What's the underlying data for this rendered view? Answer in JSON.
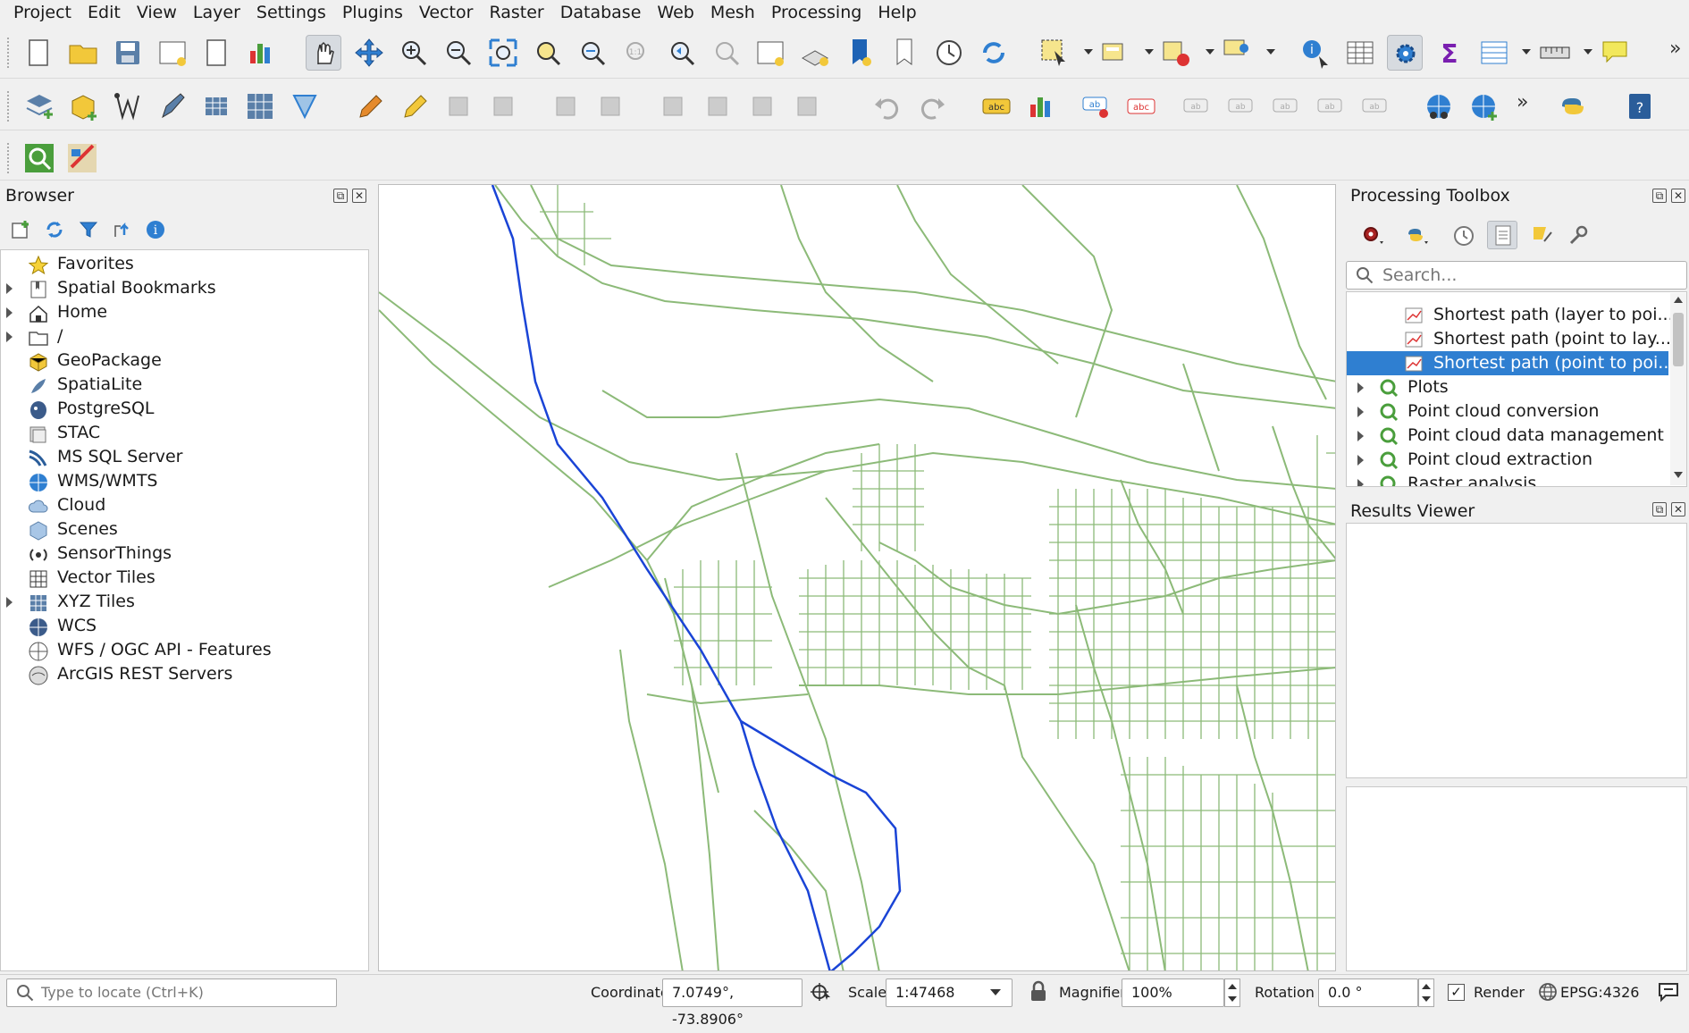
{
  "menu": [
    "Project",
    "Edit",
    "View",
    "Layer",
    "Settings",
    "Plugins",
    "Vector",
    "Raster",
    "Database",
    "Web",
    "Mesh",
    "Processing",
    "Help"
  ],
  "browser": {
    "title": "Browser",
    "items": [
      {
        "label": "Favorites",
        "icon": "star-icon",
        "expandable": false
      },
      {
        "label": "Spatial Bookmarks",
        "icon": "bookmark-icon",
        "expandable": true
      },
      {
        "label": "Home",
        "icon": "home-icon",
        "expandable": true
      },
      {
        "label": "/",
        "icon": "folder-icon",
        "expandable": true
      },
      {
        "label": "GeoPackage",
        "icon": "geopackage-icon",
        "expandable": false
      },
      {
        "label": "SpatiaLite",
        "icon": "spatialite-icon",
        "expandable": false
      },
      {
        "label": "PostgreSQL",
        "icon": "postgresql-icon",
        "expandable": false
      },
      {
        "label": "STAC",
        "icon": "stac-icon",
        "expandable": false
      },
      {
        "label": "MS SQL Server",
        "icon": "mssql-icon",
        "expandable": false
      },
      {
        "label": "WMS/WMTS",
        "icon": "wms-icon",
        "expandable": false
      },
      {
        "label": "Cloud",
        "icon": "cloud-icon",
        "expandable": false
      },
      {
        "label": "Scenes",
        "icon": "scenes-icon",
        "expandable": false
      },
      {
        "label": "SensorThings",
        "icon": "sensorthings-icon",
        "expandable": false
      },
      {
        "label": "Vector Tiles",
        "icon": "vector-tiles-icon",
        "expandable": false
      },
      {
        "label": "XYZ Tiles",
        "icon": "xyz-tiles-icon",
        "expandable": true
      },
      {
        "label": "WCS",
        "icon": "wcs-icon",
        "expandable": false
      },
      {
        "label": "WFS / OGC API - Features",
        "icon": "wfs-icon",
        "expandable": false
      },
      {
        "label": "ArcGIS REST Servers",
        "icon": "arcgis-icon",
        "expandable": false
      }
    ]
  },
  "toolbox": {
    "title": "Processing Toolbox",
    "search_placeholder": "Search...",
    "items": [
      {
        "label": "Shortest path (layer to poi...",
        "type": "algorithm",
        "selected": false
      },
      {
        "label": "Shortest path (point to lay...",
        "type": "algorithm",
        "selected": false
      },
      {
        "label": "Shortest path (point to poi...",
        "type": "algorithm",
        "selected": true
      },
      {
        "label": "Plots",
        "type": "group",
        "selected": false
      },
      {
        "label": "Point cloud conversion",
        "type": "group",
        "selected": false
      },
      {
        "label": "Point cloud data management",
        "type": "group",
        "selected": false
      },
      {
        "label": "Point cloud extraction",
        "type": "group",
        "selected": false
      },
      {
        "label": "Raster analysis",
        "type": "group",
        "selected": false
      }
    ]
  },
  "results": {
    "title": "Results Viewer"
  },
  "status": {
    "locate_placeholder": "Type to locate (Ctrl+K)",
    "coordinate_label": "Coordinate",
    "coordinate_value": "7.0749°, -73.8906°",
    "scale_label": "Scale",
    "scale_value": "1:47468",
    "magnifier_label": "Magnifier",
    "magnifier_value": "100%",
    "rotation_label": "Rotation",
    "rotation_value": "0.0 °",
    "render_label": "Render",
    "render_checked": true,
    "crs": "EPSG:4326"
  },
  "colors": {
    "roads": "#8cba78",
    "river": "#1a44d6",
    "selection": "#2f7fd1"
  }
}
